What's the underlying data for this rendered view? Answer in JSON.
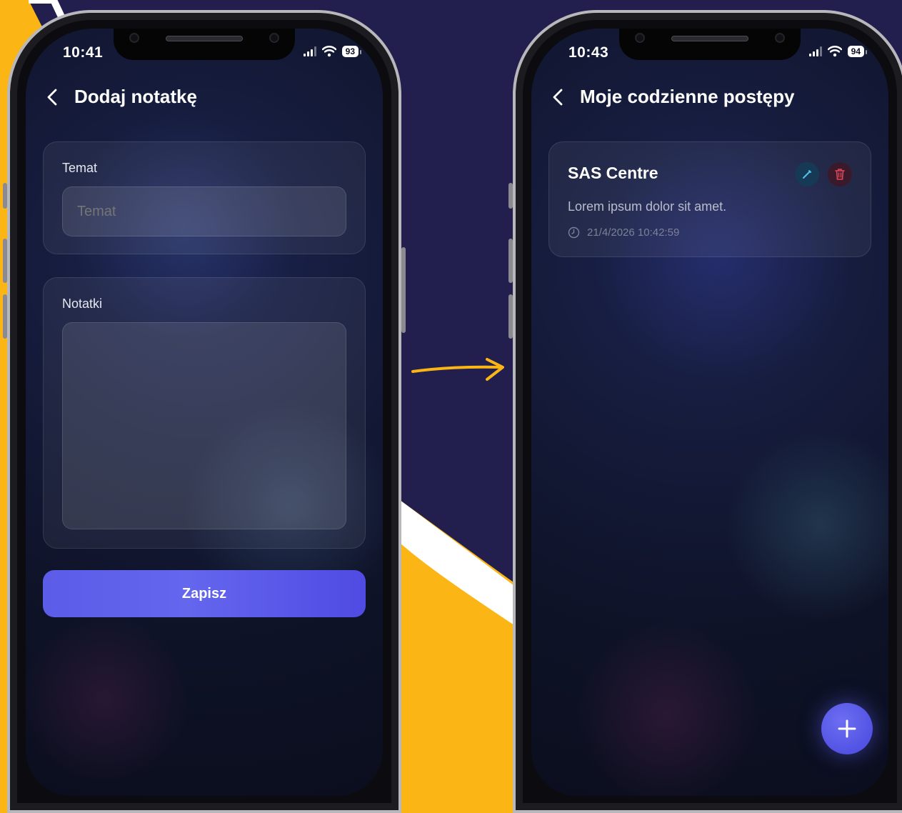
{
  "colors": {
    "background_yellow": "#fbb615",
    "background_navy": "#221f4f",
    "accent": "#5b5ce8",
    "arrow": "#fbb615"
  },
  "left_screen": {
    "status": {
      "time": "10:41",
      "battery": "93"
    },
    "header": {
      "back_icon": "chevron-left-icon",
      "title": "Dodaj notatkę"
    },
    "subject_field": {
      "label": "Temat",
      "placeholder": "Temat",
      "value": ""
    },
    "notes_field": {
      "label": "Notatki",
      "value": ""
    },
    "save_button": {
      "label": "Zapisz"
    }
  },
  "right_screen": {
    "status": {
      "time": "10:43",
      "battery": "94"
    },
    "header": {
      "back_icon": "chevron-left-icon",
      "title": "Moje codzienne postępy"
    },
    "notes": [
      {
        "title": "SAS Centre",
        "body": "Lorem ipsum dolor sit amet.",
        "timestamp": "21/4/2026 10:42:59",
        "edit_icon": "pencil-icon",
        "delete_icon": "trash-icon"
      }
    ],
    "fab_icon": "plus-icon"
  }
}
